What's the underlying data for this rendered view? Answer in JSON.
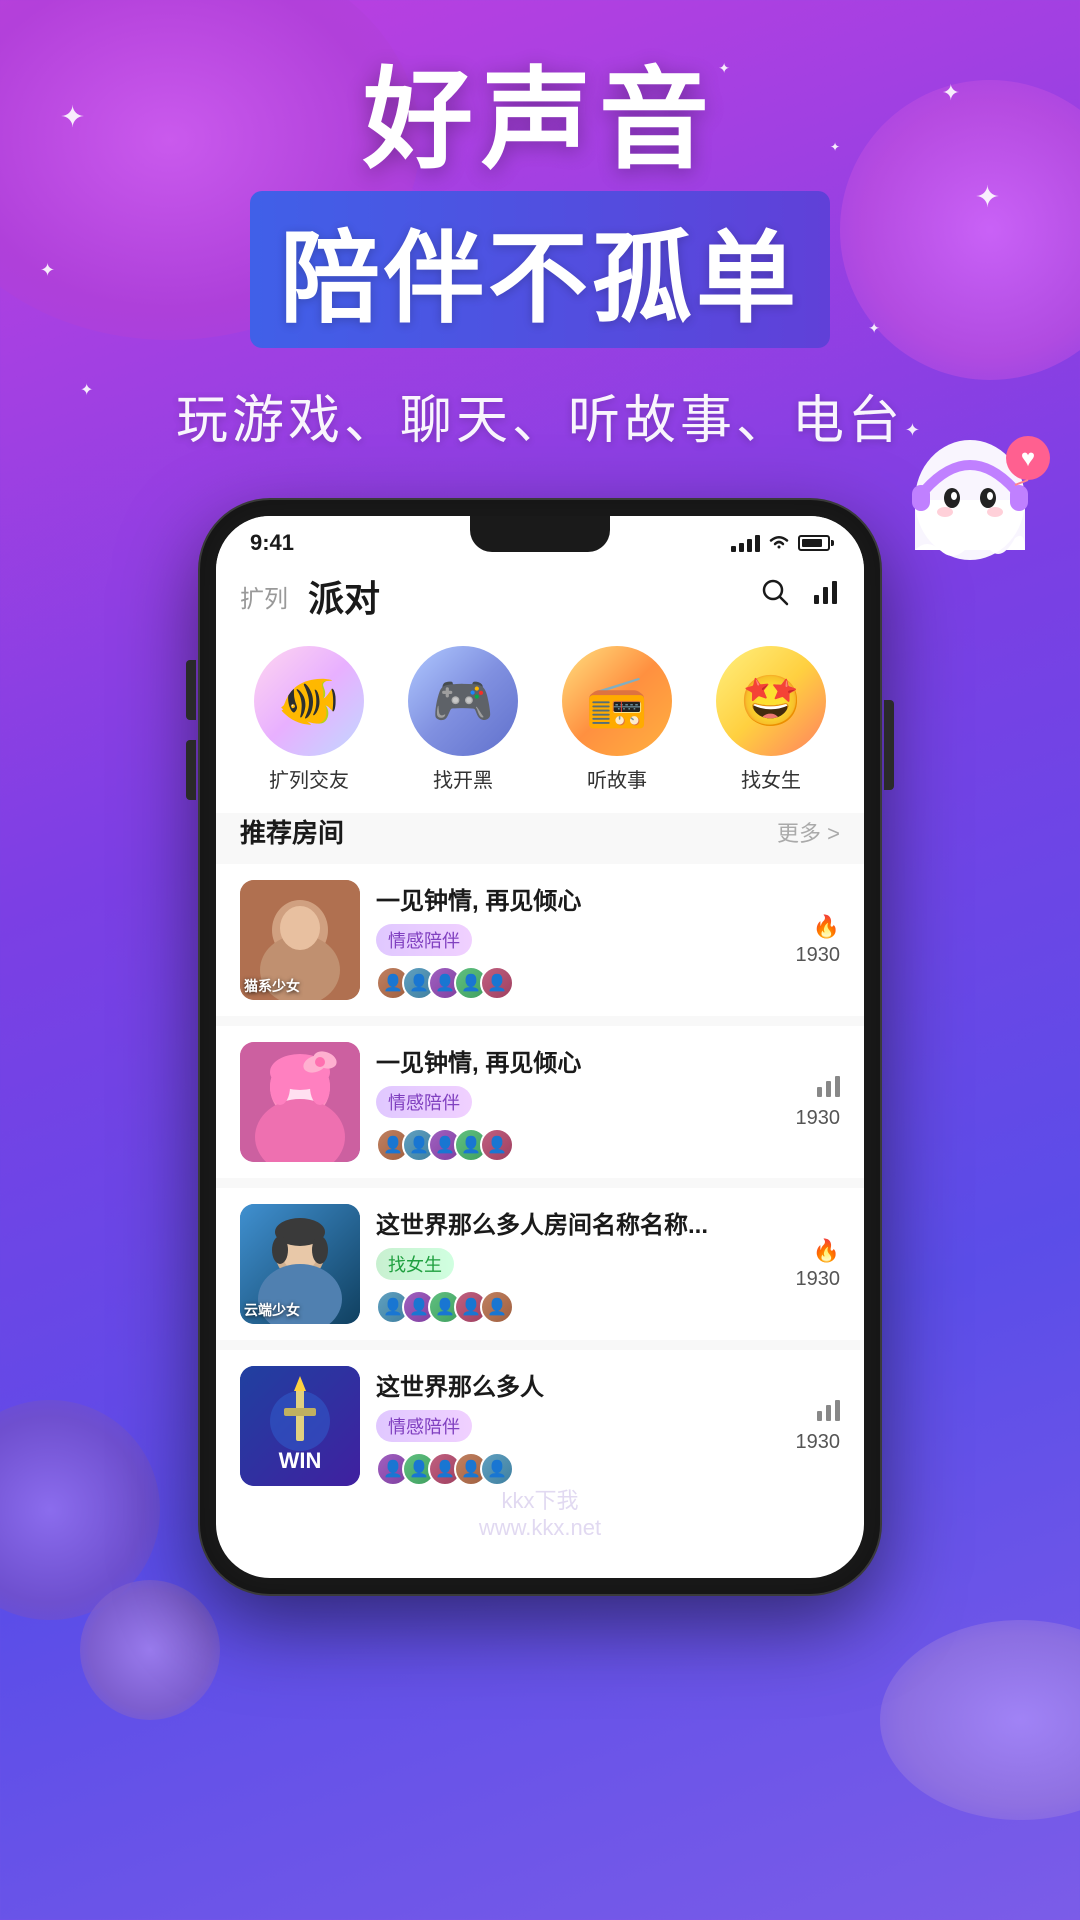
{
  "app": {
    "name": "好声音App",
    "background_colors": [
      "#c040e0",
      "#7b3fe4",
      "#5b4de8"
    ]
  },
  "hero": {
    "title_line1": "好声音",
    "title_line2": "陪伴不孤单",
    "tagline": "玩游戏、聊天、听故事、电台"
  },
  "status_bar": {
    "time": "9:41",
    "signal": "●●●",
    "wifi": "WiFi",
    "battery": "100"
  },
  "nav": {
    "expand_label": "扩列",
    "title": "派对",
    "search_label": "搜索",
    "stats_label": "统计"
  },
  "categories": [
    {
      "id": "expand",
      "label": "扩列交友",
      "emoji": "🐟"
    },
    {
      "id": "game",
      "label": "找开黑",
      "emoji": "🎮"
    },
    {
      "id": "story",
      "label": "听故事",
      "emoji": "📻"
    },
    {
      "id": "girl",
      "label": "找女生",
      "emoji": "🤩"
    }
  ],
  "recommend": {
    "section_title": "推荐房间",
    "more_label": "更多 >"
  },
  "rooms": [
    {
      "id": 1,
      "name": "一见钟情, 再见倾心",
      "tag": "情感陪伴",
      "tag_type": "purple",
      "heat_count": "1930",
      "heat_type": "fire",
      "thumb_label": "猫\n系\n少\n女",
      "thumb_class": "thumb-1"
    },
    {
      "id": 2,
      "name": "一见钟情, 再见倾心",
      "tag": "情感陪伴",
      "tag_type": "purple",
      "heat_count": "1930",
      "heat_type": "bar",
      "thumb_class": "thumb-2"
    },
    {
      "id": 3,
      "name": "这世界那么多人房间名称名称...",
      "tag": "找女生",
      "tag_type": "green",
      "heat_count": "1930",
      "heat_type": "fire",
      "thumb_label": "云端少女",
      "thumb_class": "thumb-3"
    },
    {
      "id": 4,
      "name": "这世界那么多人",
      "tag": "情感陪伴",
      "tag_type": "purple",
      "heat_count": "1930",
      "heat_type": "bar",
      "thumb_label": "WIN",
      "thumb_class": "thumb-4"
    }
  ],
  "watermark": {
    "line1": "kkx下我",
    "line2": "www.kkx.net"
  }
}
